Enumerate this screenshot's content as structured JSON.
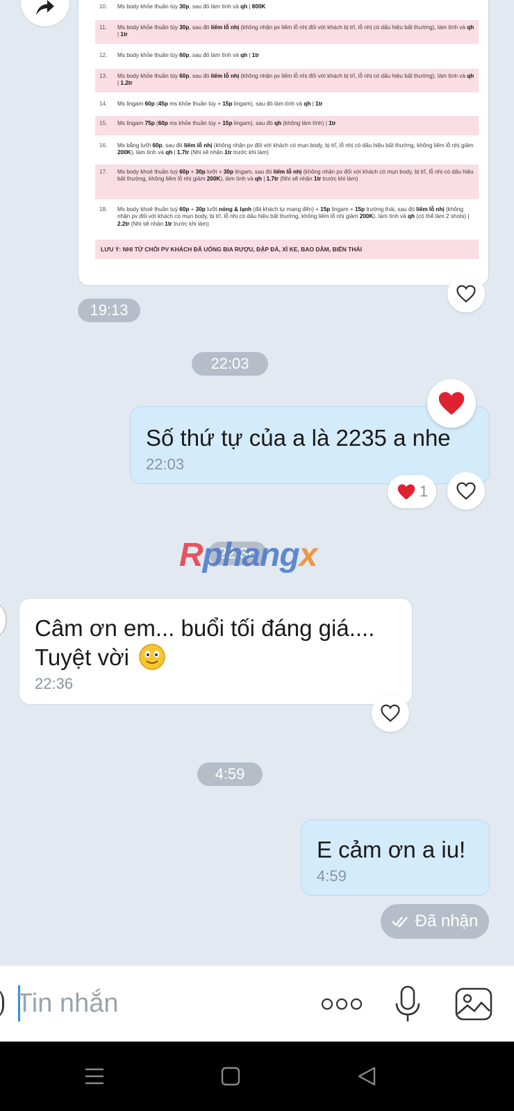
{
  "price_sheet": {
    "rows": [
      {
        "no": "10.",
        "html": "Ms body khỏe thuần túy <b>30p</b>, sau đó làm tình và <b>qh</b> | <b>800K</b>",
        "pink": false
      },
      {
        "no": "11.",
        "html": "Ms body khỏe thuần túy <b>30p</b>, sau đó <b>liếm lỗ nhị</b> (không nhận pv liếm lỗ nhị đối với khách bị trĩ, lỗ nhị có dấu hiệu bất thường), làm tình và <b>qh</b> | <b>1tr</b>",
        "pink": true
      },
      {
        "no": "12.",
        "html": "Ms body khỏe thuần túy <b>60p</b>, sau đó làm tình và <b>qh</b> | <b>1tr</b>",
        "pink": false
      },
      {
        "no": "13.",
        "html": "Ms body khỏe thuần túy <b>60p</b>, sau đó <b>liếm lỗ nhị</b> (không nhận pv liếm lỗ nhị đối với khách bị trĩ, lỗ nhị có dấu hiệu bất thường), làm tình và <b>qh</b> | <b>1.2tr</b>",
        "pink": true
      },
      {
        "no": "14.",
        "html": "Ms lingam <b>60p</b> (<b>45p</b> ms khỏe thuần túy + <b>15p</b> lingam), sau đó làm tình và <b>qh</b> | <b>1tr</b>",
        "pink": false
      },
      {
        "no": "15.",
        "html": "Ms lingam <b>75p</b> (<b>60p</b> ms khỏe thuần túy + <b>15p</b> lingam), sau đó <b>qh</b> (không làm tình) | <b>1tr</b>",
        "pink": true
      },
      {
        "no": "16.",
        "html": "Ms bằng lưỡi <b>60p</b>, sau đó <b>liếm lỗ nhị</b> (không nhận pv đối với khách có mụn body, bị trĩ, lỗ nhị có dấu hiệu bất thường, không liếm lỗ nhị giảm <b>200K</b>), làm tình và <b>qh</b> | <b>1.7tr</b> (Nhi sẽ nhận <b>1tr</b> trước khi làm)",
        "pink": false
      },
      {
        "no": "17.",
        "html": "Ms body khoẻ thuần tuý <b>60p</b> + <b>30p</b> lưỡi + <b>30p</b> lingam, sau đó <b>liếm lỗ nhị</b> (không nhận pv đối với khách có mụn body, bị trĩ, lỗ nhị có dấu hiệu bất thường, không liếm lỗ nhị giảm <b>200K</b>), làm tình và <b>qh</b> | <b>1.7tr</b> (Nhi sẽ nhận <b>1tr</b> trước khi làm)",
        "pink": true
      },
      {
        "no": "18.",
        "html": "Ms body khoẻ thuần tuý <b>60p</b> + <b>30p</b> lưỡi <b>nóng &amp; lạnh</b> (đá khách tự mang đến) + <b>15p</b> lingam + <b>15p</b> trường thái, sau đó <b>liếm lỗ nhị</b> (không nhận pv đối với khách có mụn body, bị trĩ, lỗ nhị có dấu hiệu bất thường, không liếm lỗ nhị giảm <b>200K</b>), làm tình và <b>qh</b> (có thể làm 2 shots) | <b>2.2tr</b> (Nhi sẽ nhận <b>1tr</b> trước khi làm)",
        "pink": false
      }
    ],
    "note": "LƯU Ý: NHI TỪ CHỐI PV KHÁCH ĐÃ UỐNG BIA RƯỢU, ĐẬP ĐÁ, XÌ KE, BAO DÂM, BIẾN THÁI"
  },
  "timestamps": {
    "image_time": "19:13",
    "divider_1": "22:03",
    "divider_2": "22:36",
    "divider_3": "4:59"
  },
  "messages": {
    "m1": {
      "text": "Số thứ tự của a là 2235 a nhe",
      "time": "22:03",
      "reaction_count": "1"
    },
    "m2": {
      "text": "Câm ơn em... buổi tối đáng giá.... Tuyệt vời",
      "time": "22:36"
    },
    "m3": {
      "text": "E cảm ơn a iu!",
      "time": "4:59"
    }
  },
  "delivery_status": "Đã nhận",
  "watermark": {
    "part1": "R",
    "part2": "phang",
    "part3": "x"
  },
  "input": {
    "placeholder": "Tin nhắn"
  },
  "icons": [
    "forward-icon",
    "heart-outline-icon",
    "heart-filled-icon",
    "smile-emoji",
    "double-check-icon",
    "more-icon",
    "mic-icon",
    "image-icon",
    "nav-menu-icon",
    "nav-home-icon",
    "nav-back-icon"
  ],
  "colors": {
    "accent": "#2c8fe6",
    "outgoing_bubble": "#d4ebfb",
    "heart_red": "#e02130"
  }
}
